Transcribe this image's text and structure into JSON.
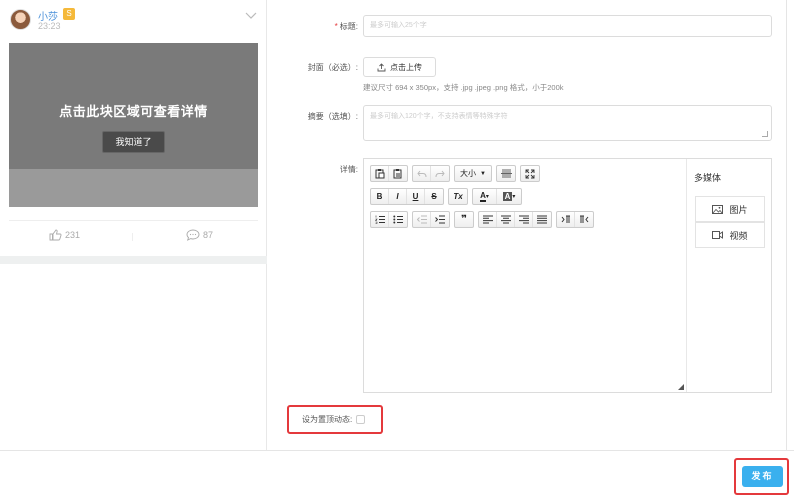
{
  "preview": {
    "user": {
      "name": "小莎",
      "badge": "S",
      "time": "23:23"
    },
    "cover_hint": "点击此块区域可查看详情",
    "got_it_label": "我知道了",
    "likes": "231",
    "comments": "87"
  },
  "form": {
    "title": {
      "label": "标题:",
      "placeholder": "最多可输入25个字"
    },
    "cover": {
      "label": "封面（必选）:",
      "upload_label": "点击上传",
      "hint": "建议尺寸 694 x 350px，支持 .jpg .jpeg .png 格式，小于200k"
    },
    "summary": {
      "label": "摘要（选填）:",
      "placeholder": "最多可输入120个字，不支持表情等特殊字符"
    },
    "details": {
      "label": "详情:"
    },
    "editor": {
      "font_size_label": "大小",
      "buttons": {
        "bold": "B",
        "italic": "I",
        "underline": "U",
        "strike": "S",
        "clear_format": "Tx",
        "font_color": "A",
        "bg_color": "A",
        "quote": "❞"
      }
    },
    "media": {
      "title": "多媒体",
      "image_label": "图片",
      "video_label": "视频"
    },
    "pin": {
      "label": "设为置顶动态:",
      "checked": false
    }
  },
  "publish_label": "发布",
  "colors": {
    "accent": "#3ab0ee",
    "highlight": "#e4393c",
    "link": "#4a90d9"
  }
}
